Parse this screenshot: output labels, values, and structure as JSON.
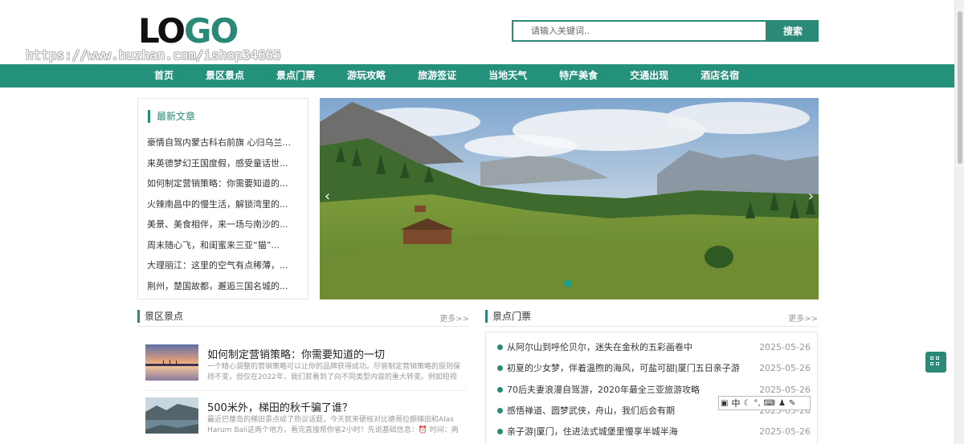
{
  "header": {
    "logo_part1": "LO",
    "logo_part2": "GO",
    "watermark": "https://www.huzhan.com/ishop34665",
    "search_placeholder": "请输入关键词..",
    "search_button": "搜索"
  },
  "nav": {
    "items": [
      "首页",
      "景区景点",
      "景点门票",
      "游玩攻略",
      "旅游签证",
      "当地天气",
      "特产美食",
      "交通出现",
      "酒店名宿"
    ]
  },
  "latest": {
    "title": "最新文章",
    "items": [
      "豪情自驾内蒙古科右前旗 心归乌兰...",
      "来英德梦幻王国度假，感受童话世...",
      "如何制定营销策略：你需要知道的...",
      "火辣南昌中的慢生活，解锁湾里的...",
      "美景、美食相伴，来一场与南沙的...",
      "周末随心飞，和闺蜜来三亚“猫”...",
      "大理丽江：这里的空气有点稀薄，...",
      "荆州，楚国故都，邂逅三国名城的..."
    ]
  },
  "banner": {
    "prev_icon": "‹",
    "next_icon": "›"
  },
  "scenic": {
    "title": "景区景点",
    "more": "更多>>",
    "cards": [
      {
        "title": "如何制定营销策略：你需要知道的一切",
        "desc": "一个精心调整的营销策略可以让你的品牌获得成功。尽管制定营销策略的原则保持不变，但仅在2022年，我们就看到了向不同类型内容的重大转变。例如短视频..."
      },
      {
        "title": "500米外，梯田的秋千骗了谁？",
        "desc": "最近巴厘岛的梯田景点成了热议话题，今天就来硬核对比德哥拉朗梯田和Alas Harum Bali这两个地方，看完直接帮你省2小时！先说基础信息：⏰ 时间：两个景"
      }
    ]
  },
  "tickets": {
    "title": "景点门票",
    "more": "更多>>",
    "items": [
      {
        "text": "从阿尔山到呼伦贝尔，迷失在金秋的五彩画卷中",
        "date": "2025-05-26"
      },
      {
        "text": "初夏的少女梦，伴着温煦的海风，可盐可甜|厦门五日亲子游",
        "date": "2025-05-26"
      },
      {
        "text": "70后夫妻浪漫自驾游，2020年最全三亚旅游攻略",
        "date": "2025-05-26"
      },
      {
        "text": "感悟禅道、圆梦武侠，舟山，我们后会有期",
        "date": "2025-05-26"
      },
      {
        "text": "亲子游|厦门，住进法式城堡里慢享半城半海",
        "date": "2025-05-26"
      }
    ]
  },
  "ime": {
    "lang": "中"
  },
  "colors": {
    "brand": "#24917a",
    "accent": "#2a8a77"
  }
}
